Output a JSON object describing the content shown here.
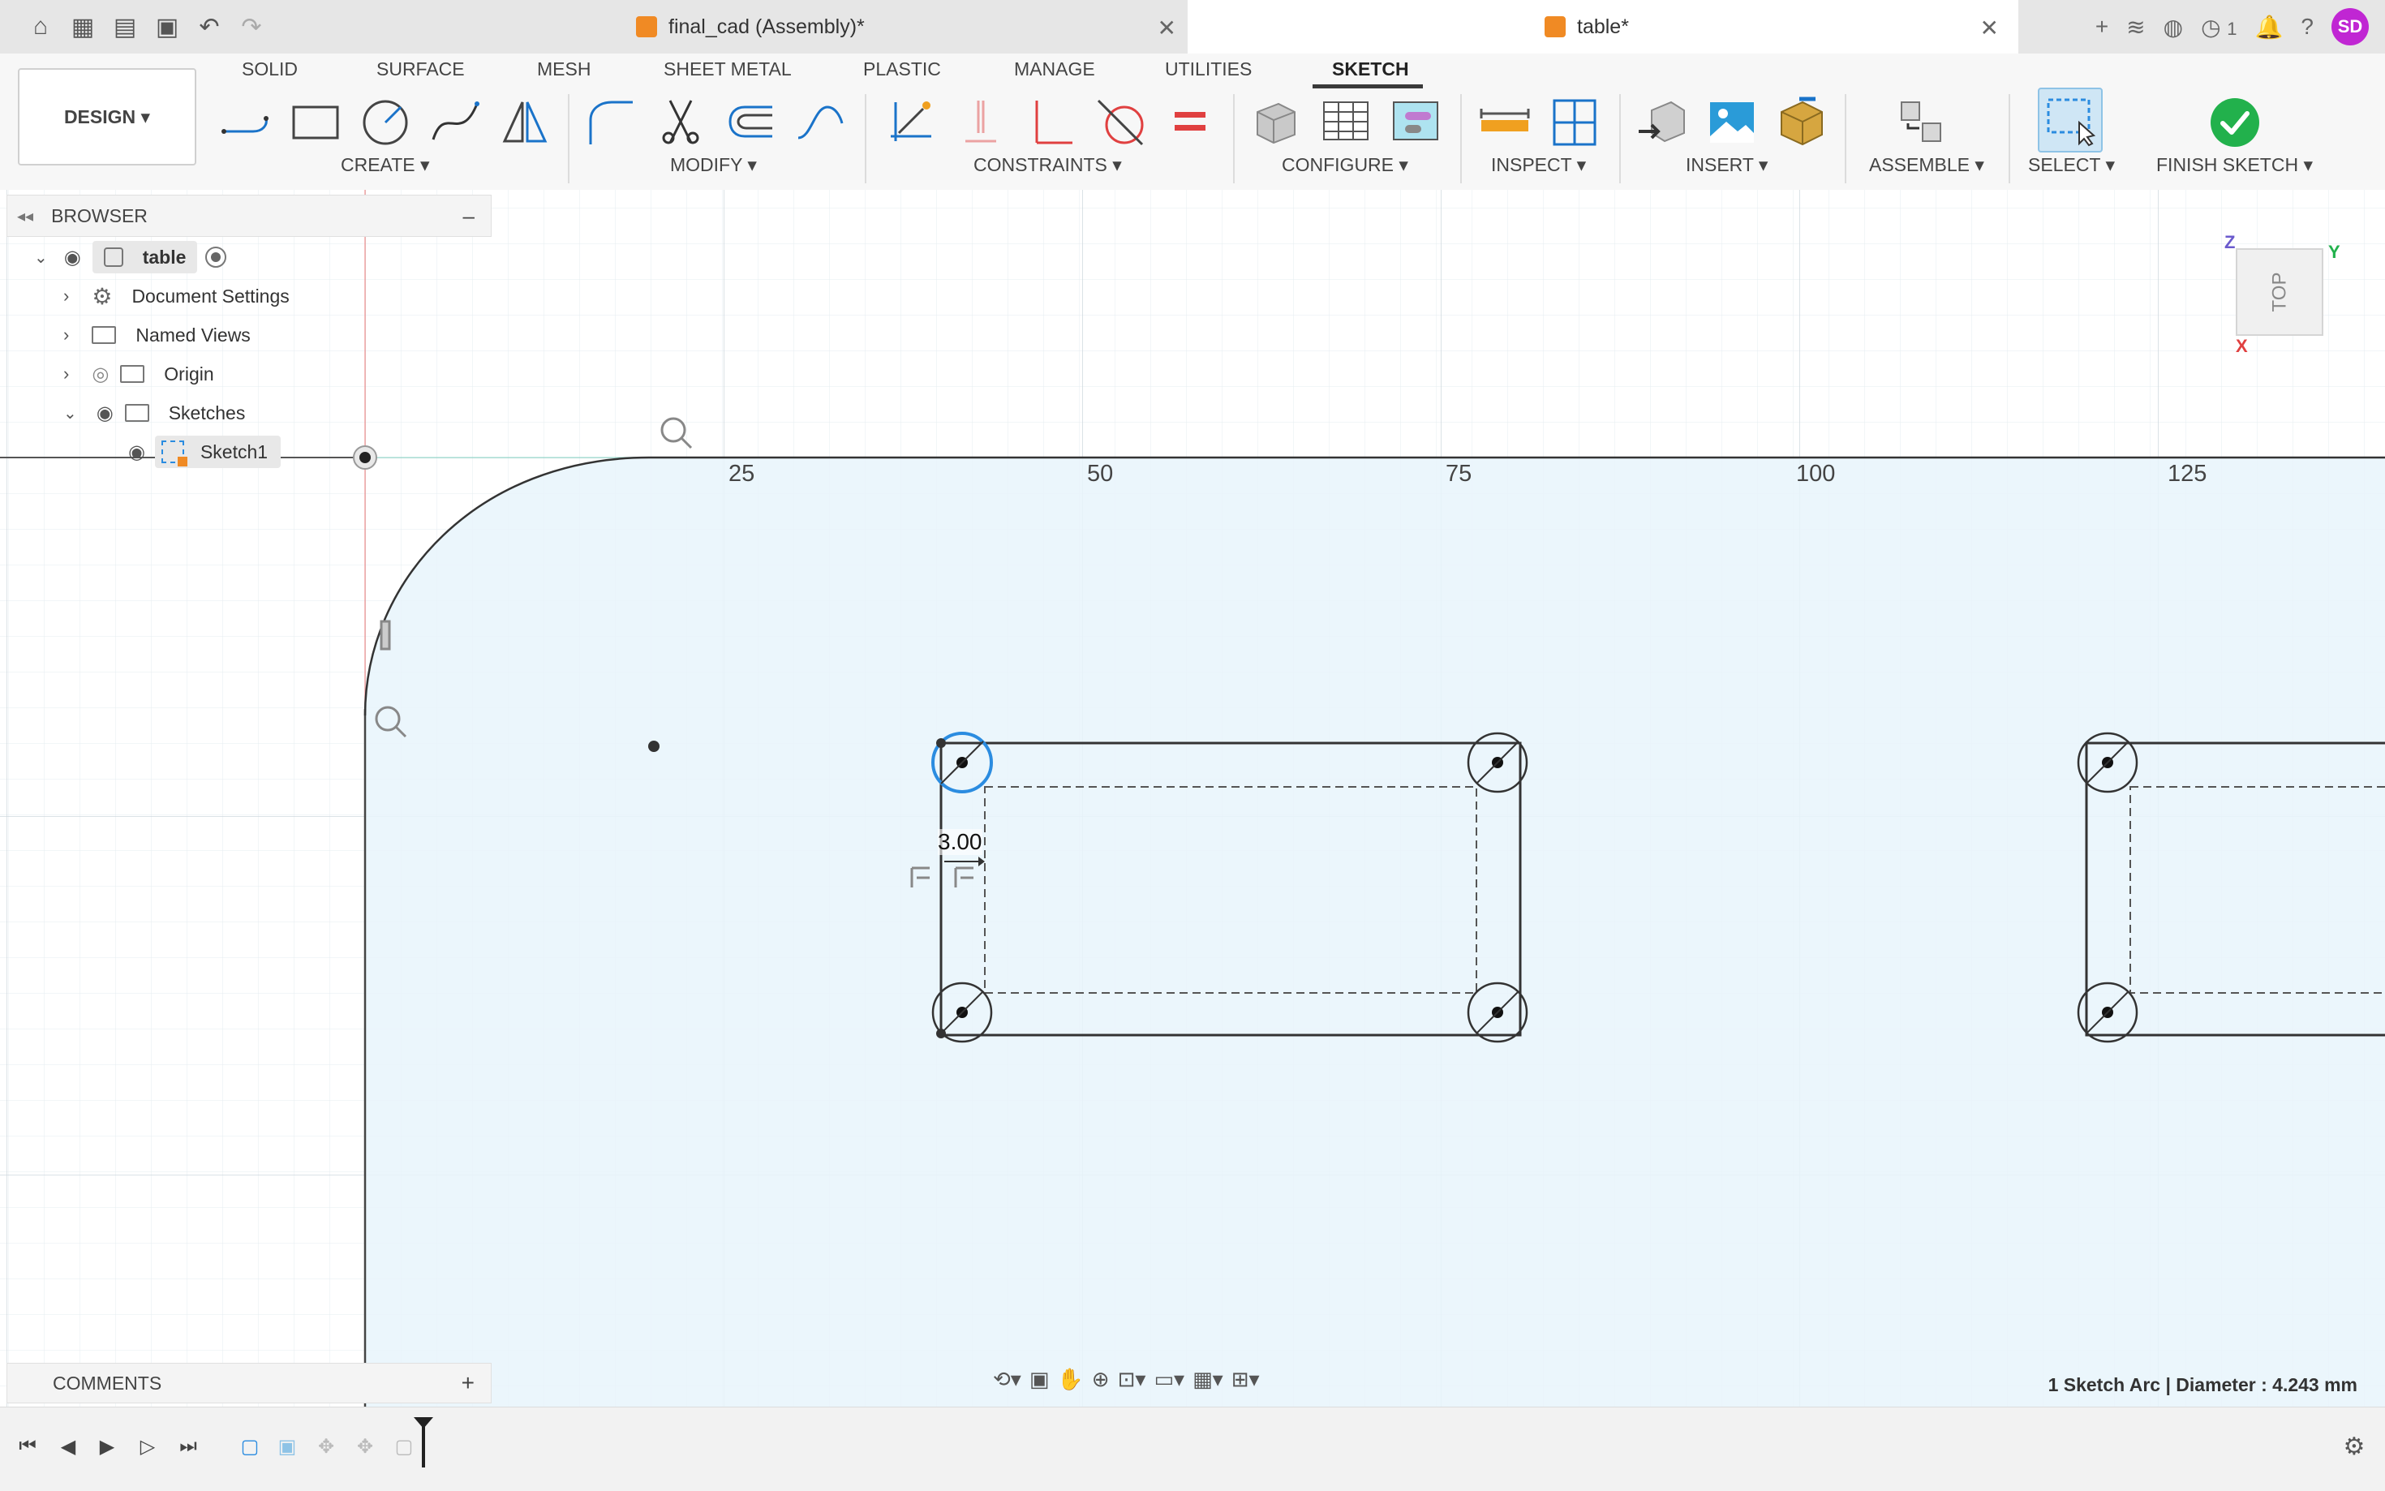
{
  "tabs": [
    {
      "label": "final_cad (Assembly)*",
      "active": false
    },
    {
      "label": "table*",
      "active": true
    }
  ],
  "header_right": {
    "jobs_count": "1",
    "avatar_initials": "SD"
  },
  "design_button": "DESIGN",
  "ribbon_tabs": [
    "SOLID",
    "SURFACE",
    "MESH",
    "SHEET METAL",
    "PLASTIC",
    "MANAGE",
    "UTILITIES",
    "SKETCH"
  ],
  "ribbon_groups": {
    "create": "CREATE",
    "modify": "MODIFY",
    "constraints": "CONSTRAINTS",
    "configure": "CONFIGURE",
    "inspect": "INSPECT",
    "insert": "INSERT",
    "assemble": "ASSEMBLE",
    "select": "SELECT",
    "finish": "FINISH SKETCH"
  },
  "browser": {
    "title": "BROWSER",
    "root": "table",
    "items": [
      "Document Settings",
      "Named Views",
      "Origin",
      "Sketches",
      "Sketch1"
    ]
  },
  "comments": "COMMENTS",
  "ruler_ticks": [
    "25",
    "50",
    "75",
    "100",
    "125"
  ],
  "dimension_value": "3.00",
  "viewcube_face": "TOP",
  "axis_labels": {
    "z": "Z",
    "y": "Y",
    "x": "X"
  },
  "status_text": "1 Sketch Arc | Diameter : 4.243 mm",
  "colors": {
    "sketch_fill": "#e8f4fb",
    "selected_circle": "#2b8ce0",
    "finish_green": "#22b14c",
    "accent_orange": "#f08a24",
    "avatar_magenta": "#c026d3"
  }
}
